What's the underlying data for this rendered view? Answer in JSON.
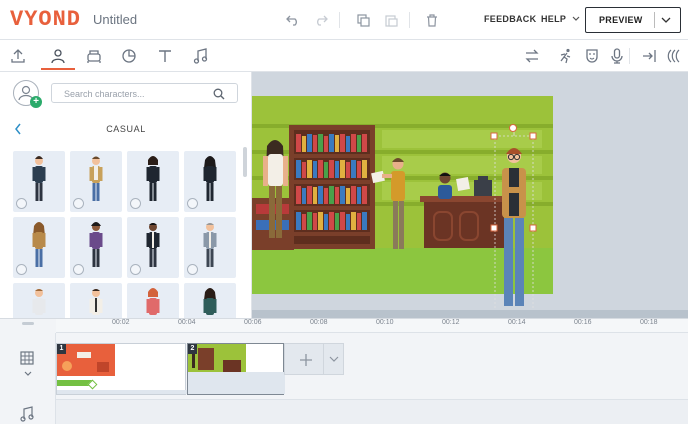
{
  "app": {
    "logo": "VYOND",
    "title": "Untitled"
  },
  "header": {
    "feedback_label": "FEEDBACK",
    "help_label": "HELP",
    "preview_label": "PREVIEW"
  },
  "toolbar": {
    "tabs": [
      {
        "icon": "upload-icon"
      },
      {
        "icon": "character-icon",
        "active": true
      },
      {
        "icon": "prop-icon"
      },
      {
        "icon": "chart-icon"
      },
      {
        "icon": "text-icon"
      },
      {
        "icon": "music-icon"
      }
    ],
    "right_tools": [
      "swap-icon",
      "action-icon",
      "expression-icon",
      "microphone-icon",
      "enter-effect-icon",
      "motion-path-icon"
    ]
  },
  "panel": {
    "search_placeholder": "Search characters...",
    "category_title": "CASUAL"
  },
  "timeline": {
    "ticks": [
      "00:02",
      "00:04",
      "00:06",
      "00:08",
      "00:10",
      "00:12",
      "00:14",
      "00:16",
      "00:18"
    ],
    "scenes": [
      {
        "number": "1"
      },
      {
        "number": "2"
      }
    ]
  },
  "colors": {
    "accent": "#e8603c",
    "stage_wall": "#9cc23a",
    "stage_floor": "#8cc63f",
    "selection_green": "#74c043"
  }
}
